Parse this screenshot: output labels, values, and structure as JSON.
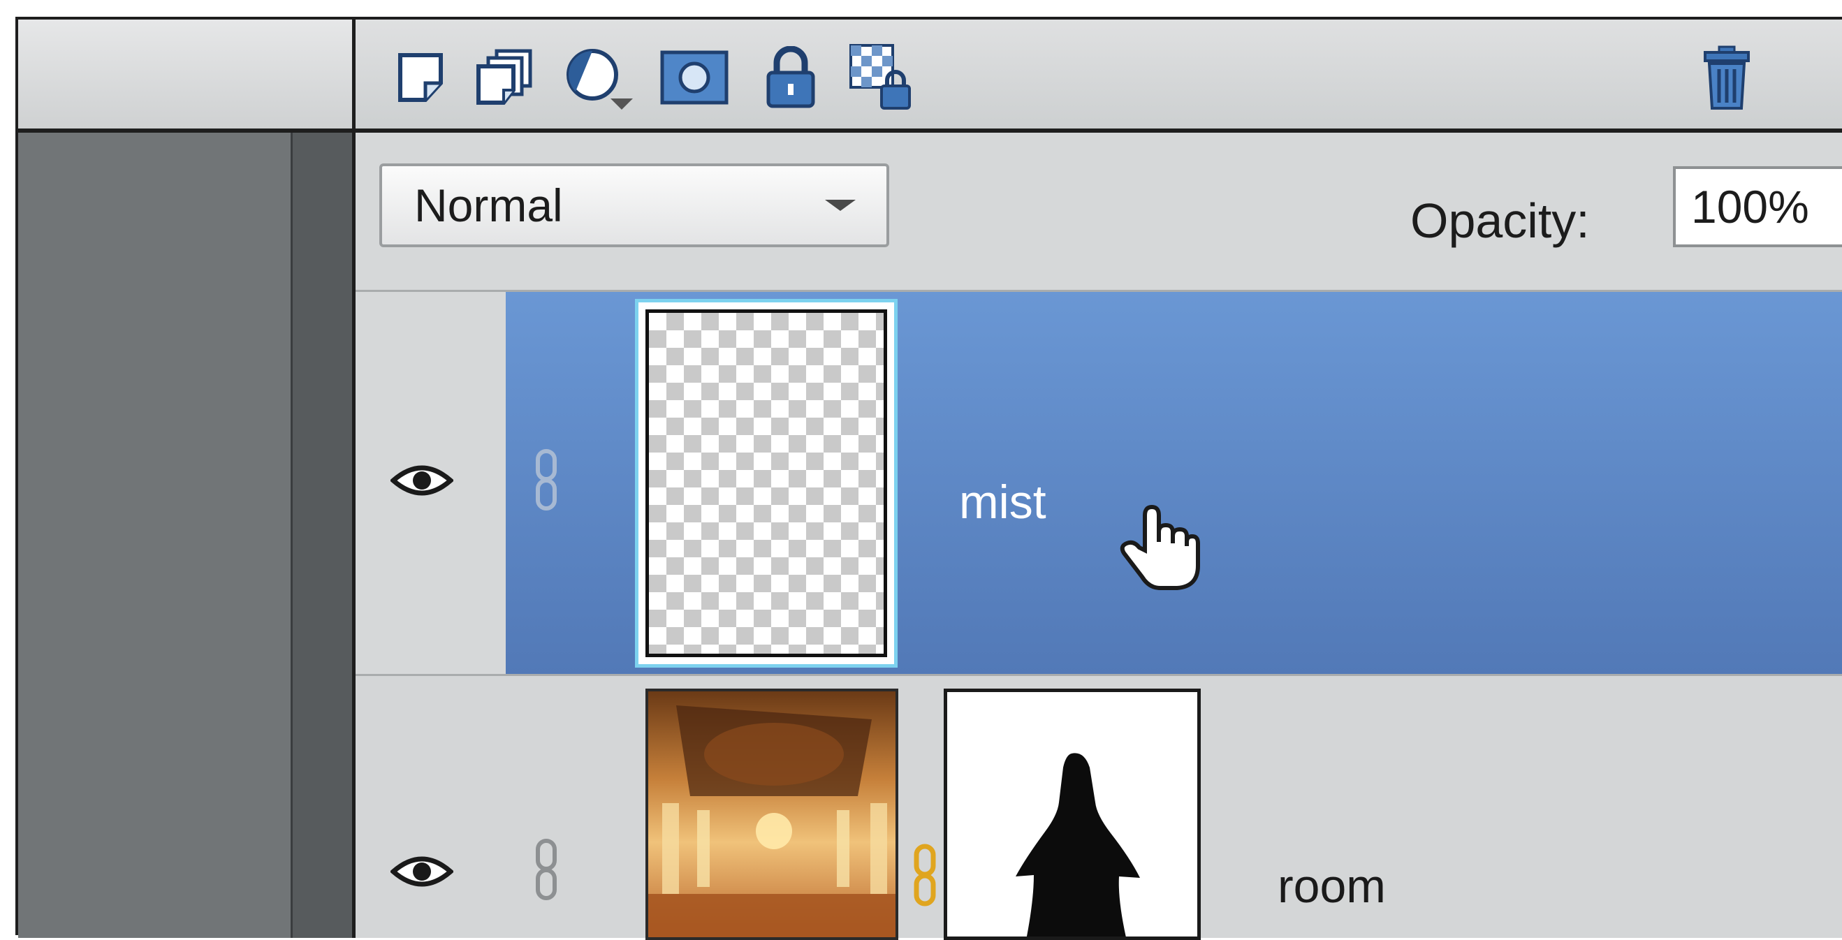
{
  "toolbar": {
    "icons": [
      "new-layer-icon",
      "new-group-icon",
      "adjustment-layer-icon",
      "layer-mask-icon",
      "lock-all-icon",
      "lock-transparency-icon",
      "trash-icon"
    ]
  },
  "blend": {
    "mode": "Normal",
    "opacity_label": "Opacity:",
    "opacity_value": "100%"
  },
  "layers": [
    {
      "name": "mist",
      "selected": true,
      "visible": true,
      "thumbnail": "transparent"
    },
    {
      "name": "room",
      "selected": false,
      "visible": true,
      "thumbnail": "palace-hall-photo",
      "mask": "silhouette-figure"
    }
  ],
  "colors": {
    "selection": "#5f8ccb",
    "panel_bg": "#d6d8d9",
    "chain_link_active": "#e0a51f"
  }
}
